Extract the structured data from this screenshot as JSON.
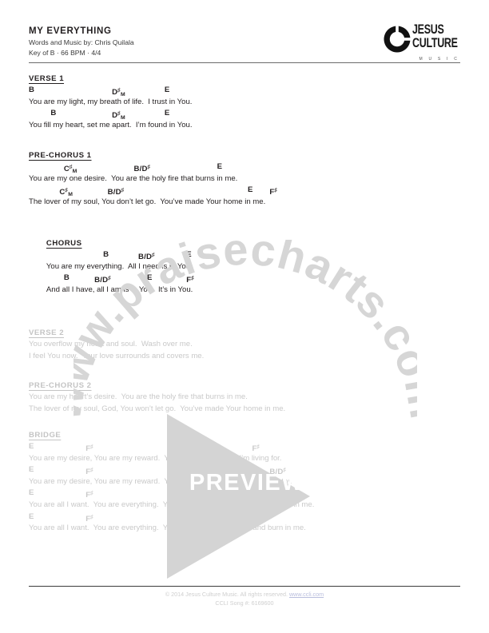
{
  "header": {
    "title": "MY EVERYTHING",
    "credit": "Words and Music by: Chris Quilala",
    "key_line": "Key of B · 66 BPM · 4/4"
  },
  "logo": {
    "mark": "jesus-culture-ring-icon",
    "word1": "JESUS",
    "word2": "CULTURE",
    "word3": "M U S I C"
  },
  "sections": [
    {
      "label": "VERSE 1",
      "faded": false,
      "lines": [
        {
          "type": "chords",
          "chords": [
            {
              "text": "B",
              "col": 0
            },
            {
              "text": "D",
              "sharp": true,
              "minor": true,
              "col": 19
            },
            {
              "text": "E",
              "col": 31
            }
          ]
        },
        {
          "type": "lyrics",
          "text": "You are my light, my breath of life.  I trust in You."
        },
        {
          "type": "chords",
          "chords": [
            {
              "text": "B",
              "col": 5
            },
            {
              "text": "D",
              "sharp": true,
              "minor": true,
              "col": 19
            },
            {
              "text": "E",
              "col": 31
            }
          ]
        },
        {
          "type": "lyrics",
          "text": "You fill my heart, set me apart.  I’m found in You."
        }
      ]
    },
    {
      "label": "PRE-CHORUS 1",
      "faded": false,
      "lines": [
        {
          "type": "chords",
          "chords": [
            {
              "text": "C",
              "sharp": true,
              "minor": true,
              "col": 8
            },
            {
              "text": "B/D",
              "sharp": true,
              "col": 24
            },
            {
              "text": "E",
              "col": 43
            }
          ]
        },
        {
          "type": "lyrics",
          "text": "You are my one desire.  You are the holy fire that burns in me."
        },
        {
          "type": "chords",
          "chords": [
            {
              "text": "C",
              "sharp": true,
              "minor": true,
              "col": 7
            },
            {
              "text": "B/D",
              "sharp": true,
              "col": 18
            },
            {
              "text": "E",
              "col": 50
            },
            {
              "text": "F",
              "sharp": true,
              "col": 55
            }
          ]
        },
        {
          "type": "lyrics",
          "text": "The lover of my soul, You don’t let go.  You’ve made Your home in me."
        }
      ]
    },
    {
      "label": "CHORUS",
      "faded": false,
      "indent": 4,
      "lines": [
        {
          "type": "chords",
          "chords": [
            {
              "text": "B",
              "col": 13
            },
            {
              "text": "B/D",
              "sharp": true,
              "col": 21
            },
            {
              "text": "E",
              "col": 32
            }
          ]
        },
        {
          "type": "lyrics",
          "text": "You are my everything.  All I need is in You."
        },
        {
          "type": "chords",
          "chords": [
            {
              "text": "B",
              "col": 4
            },
            {
              "text": "B/D",
              "sharp": true,
              "col": 11
            },
            {
              "text": "E",
              "col": 23
            },
            {
              "text": "F",
              "sharp": true,
              "col": 32
            }
          ]
        },
        {
          "type": "lyrics",
          "text": "And all I have, all I am is in You.  It’s in You."
        }
      ]
    },
    {
      "label": "VERSE 2",
      "faded": true,
      "lines": [
        {
          "type": "lyrics",
          "text": "You overflow my heart and soul.  Wash over me."
        },
        {
          "type": "lyrics",
          "text": "I feel You now.  Your love surrounds and covers me."
        }
      ]
    },
    {
      "label": "PRE-CHORUS 2",
      "faded": true,
      "lines": [
        {
          "type": "lyrics",
          "text": "You are my heart’s desire.  You are the holy fire that burns in me."
        },
        {
          "type": "lyrics",
          "text": "The lover of my soul, God, You won’t let go.  You’ve made Your home in me."
        }
      ]
    },
    {
      "label": "BRIDGE",
      "faded": true,
      "lines": [
        {
          "type": "chords",
          "chords": [
            {
              "text": "E",
              "col": 0
            },
            {
              "text": "F",
              "sharp": true,
              "col": 13
            },
            {
              "text": "E",
              "col": 34
            },
            {
              "text": "F",
              "sharp": true,
              "col": 51
            }
          ]
        },
        {
          "type": "lyrics",
          "text": "You are my desire, You are my reward.  You are my desire, all I’m living for."
        },
        {
          "type": "chords",
          "chords": [
            {
              "text": "E",
              "col": 0
            },
            {
              "text": "F",
              "sharp": true,
              "col": 13
            },
            {
              "text": "E",
              "col": 34
            },
            {
              "text": "F",
              "sharp": true,
              "col": 51
            },
            {
              "text": "B/D",
              "sharp": true,
              "col": 55
            }
          ]
        },
        {
          "type": "lyrics",
          "text": "You are my desire, You are my reward.  You are my desire,      all I’m living for."
        },
        {
          "type": "chords",
          "chords": [
            {
              "text": "E",
              "col": 0
            },
            {
              "text": "F",
              "sharp": true,
              "col": 13
            },
            {
              "text": "G",
              "sharp": true,
              "minor": true,
              "col": 34
            },
            {
              "text": "F",
              "sharp": true,
              "col": 51
            },
            {
              "text": "B/D",
              "sharp": true,
              "col": 55
            }
          ]
        },
        {
          "type": "lyrics",
          "text": "You are all I want.  You are everything.  You are my desire.      Come and burn in me."
        },
        {
          "type": "chords",
          "chords": [
            {
              "text": "E",
              "col": 0
            },
            {
              "text": "F",
              "sharp": true,
              "col": 13
            },
            {
              "text": "G",
              "sharp": true,
              "minor": true,
              "col": 33
            },
            {
              "text": "F",
              "sharp": true,
              "slash": "/A",
              "slashsharp": true,
              "col": 49
            }
          ]
        },
        {
          "type": "lyrics",
          "text": "You are all I want.  You are everything.  You are my desire.  Come and burn in me."
        }
      ]
    }
  ],
  "watermarks": {
    "arc_text": "www.praisecharts.com",
    "preview_label": "PREVIEW",
    "play_icon": "play-triangle-icon"
  },
  "footer": {
    "copyright_pre": "© 2014 Jesus Culture Music.  All rights reserved. ",
    "link": "www.ccli.com",
    "ccli": "CCLI Song #: 6169600"
  }
}
